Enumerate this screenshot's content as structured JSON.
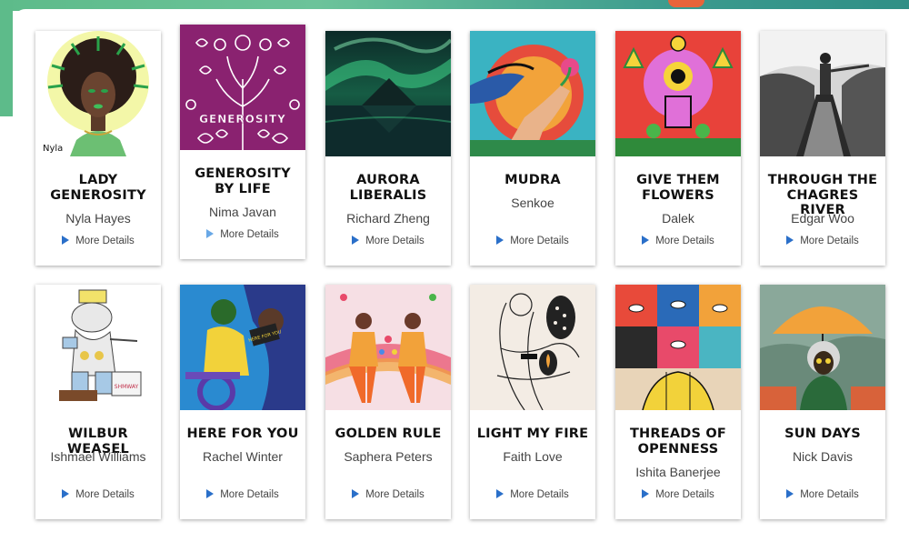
{
  "gallery": {
    "more_details_label": "More Details",
    "cards": [
      {
        "title": "Lady Generosity",
        "artist": "Nyla Hayes"
      },
      {
        "title": "Generosity by Life",
        "artist": "Nima Javan"
      },
      {
        "title": "Aurora Liberalis",
        "artist": "Richard Zheng"
      },
      {
        "title": "Mudra",
        "artist": "Senkoe"
      },
      {
        "title": "Give Them Flowers",
        "artist": "Dalek"
      },
      {
        "title": "Through the Chagres River",
        "artist": "Edgar Woo"
      },
      {
        "title": "Wilbur Weasel",
        "artist": "Ishmael Williams"
      },
      {
        "title": "Here for You",
        "artist": "Rachel Winter"
      },
      {
        "title": "Golden Rule",
        "artist": "Saphera Peters"
      },
      {
        "title": "Light My Fire",
        "artist": "Faith Love"
      },
      {
        "title": "Threads of Openness",
        "artist": "Ishita Banerjee"
      },
      {
        "title": "Sun Days",
        "artist": "Nick Davis"
      }
    ],
    "artwork_texts": {
      "generosity_word": "GENEROSITY",
      "wilbur_sign": "SHMWAY",
      "here_for_you_sign": "HERE FOR YOU"
    }
  }
}
